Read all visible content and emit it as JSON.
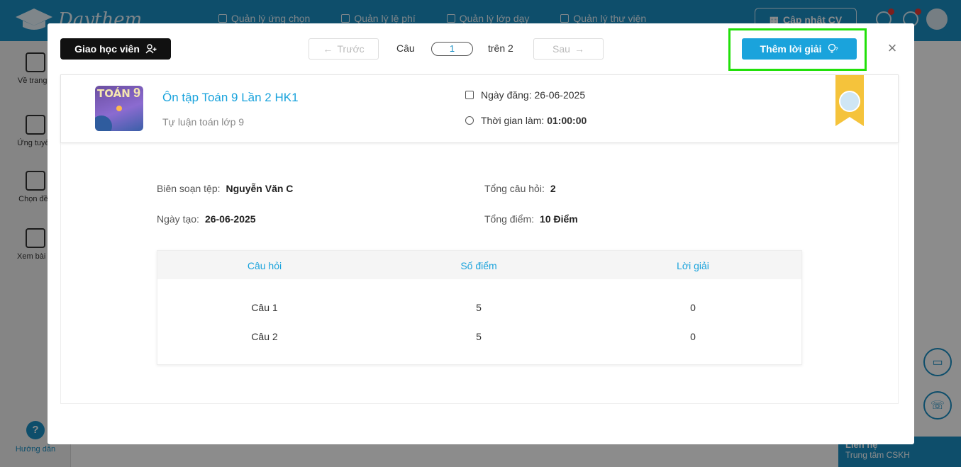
{
  "app": {
    "brand": "Daythem",
    "nav": [
      "Quản lý ứng chọn",
      "Quản lý lệ phí",
      "Quản lý lớp dạy",
      "Quản lý thư viện"
    ],
    "update_cv": "Cập nhật CV",
    "sidebar": [
      "Về trang c",
      "Ứng tuyển",
      "Chọn đề t",
      "Xem bài gi"
    ],
    "help": "Hướng dẫn",
    "cskh_title": "Liên hệ",
    "cskh_sub": "Trung tâm CSKH"
  },
  "modal": {
    "assign_label": "Giao học viên",
    "prev_label": "Trước",
    "next_label": "Sau",
    "question_label": "Câu",
    "question_value": "1",
    "total_label": "trên 2",
    "add_solution_label": "Thêm lời giải",
    "close": "×"
  },
  "exam": {
    "thumb_text": "TOÁN",
    "thumb_grade": "9",
    "title": "Ôn tập Toán 9 Lần 2 HK1",
    "subtitle": "Tự luận toán lớp 9",
    "posted_label": "Ngày đăng: 26-06-2025",
    "duration_label": "Thời gian làm:",
    "duration_value": "01:00:00"
  },
  "info": {
    "author_label": "Biên soạn tệp:",
    "author_value": "Nguyễn Văn C",
    "created_label": "Ngày tạo:",
    "created_value": "26-06-2025",
    "questions_label": "Tổng câu hỏi:",
    "questions_value": "2",
    "points_label": "Tổng điểm:",
    "points_value": "10 Điểm"
  },
  "table": {
    "headers": [
      "Câu hỏi",
      "Số điểm",
      "Lời giải"
    ],
    "rows": [
      [
        "Câu 1",
        "5",
        "0"
      ],
      [
        "Câu 2",
        "5",
        "0"
      ]
    ]
  },
  "colors": {
    "primary": "#1aa3dc",
    "header": "#1a8fc4",
    "highlight": "#22e00a",
    "ribbon": "#f5c33b"
  }
}
